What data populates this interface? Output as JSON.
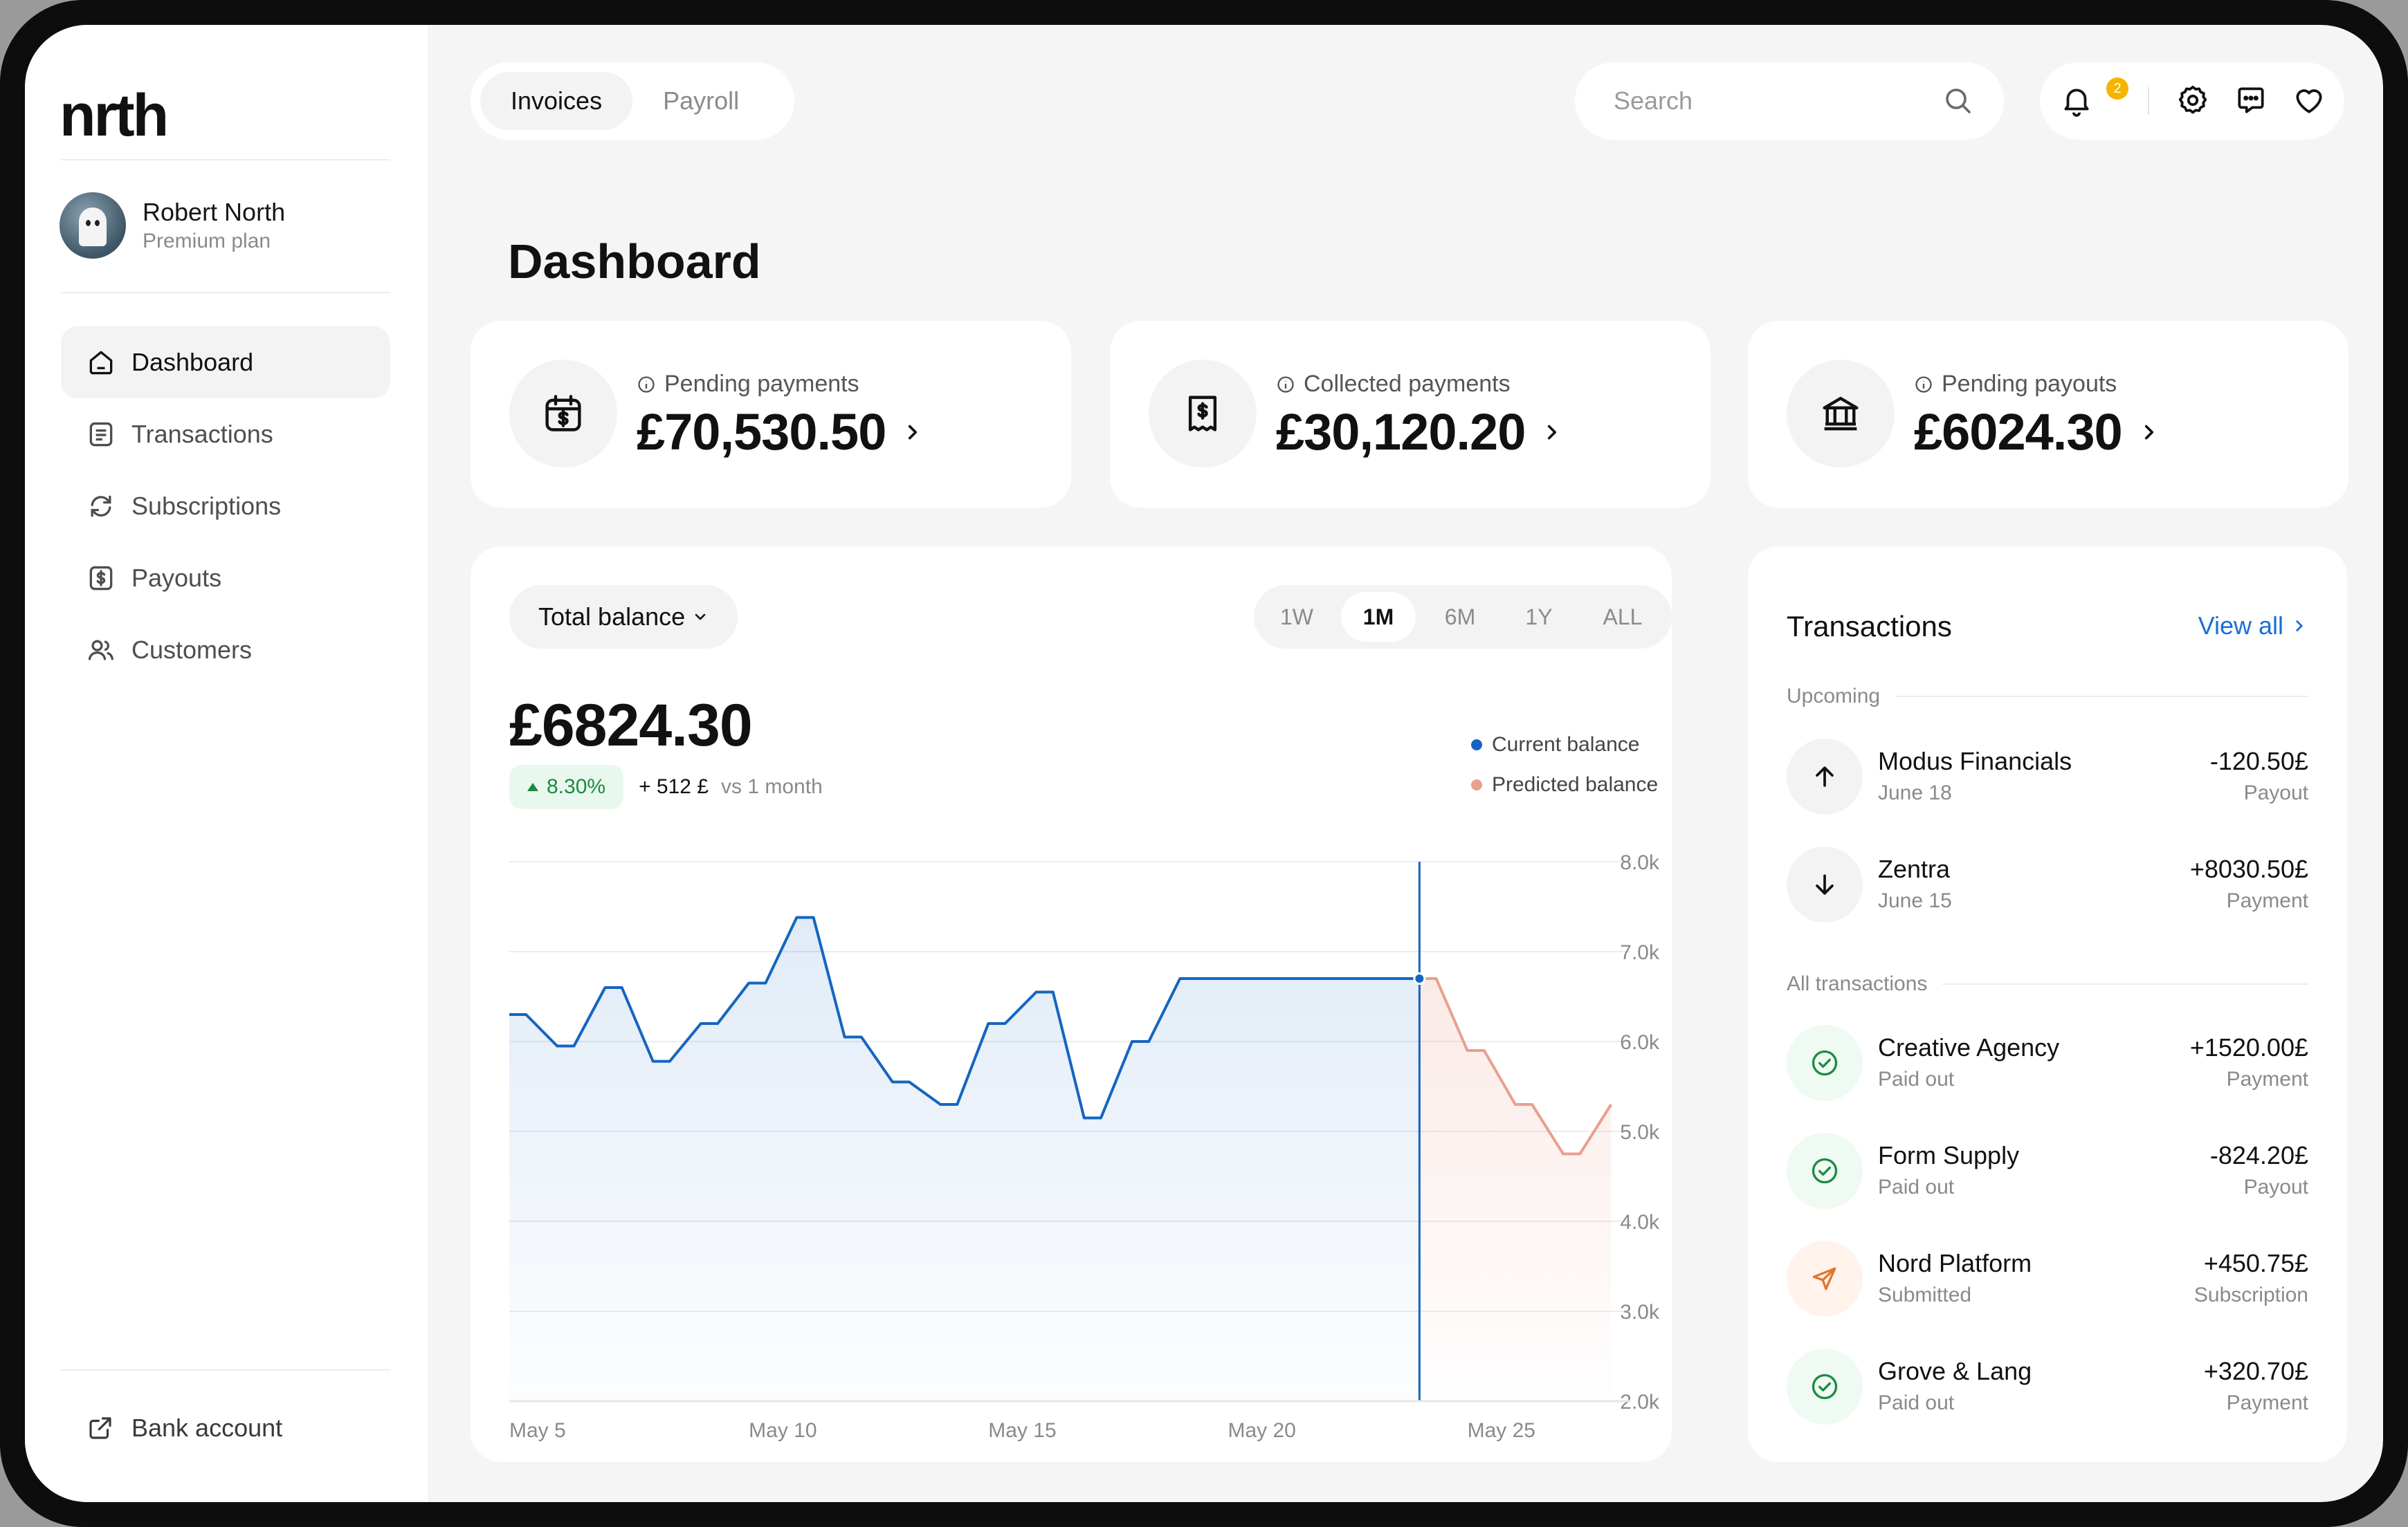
{
  "app": {
    "logo": "nrth"
  },
  "user": {
    "name": "Robert North",
    "plan": "Premium plan"
  },
  "sidebar": {
    "items": [
      {
        "label": "Dashboard",
        "icon": "home-icon",
        "active": true
      },
      {
        "label": "Transactions",
        "icon": "list-icon"
      },
      {
        "label": "Subscriptions",
        "icon": "refresh-icon"
      },
      {
        "label": "Payouts",
        "icon": "dollar-icon"
      },
      {
        "label": "Customers",
        "icon": "users-icon"
      }
    ],
    "bank_account": "Bank account"
  },
  "topbar": {
    "tabs": [
      {
        "label": "Invoices",
        "active": true
      },
      {
        "label": "Payroll"
      }
    ],
    "search_placeholder": "Search",
    "notification_count": "2"
  },
  "page_title": "Dashboard",
  "stats": [
    {
      "label": "Pending payments",
      "value": "£70,530.50",
      "icon": "calendar-dollar-icon"
    },
    {
      "label": "Collected payments",
      "value": "£30,120.20",
      "icon": "receipt-icon"
    },
    {
      "label": "Pending payouts",
      "value": "£6024.30",
      "icon": "bank-icon"
    }
  ],
  "balance": {
    "selector": "Total balance",
    "ranges": [
      "1W",
      "1M",
      "6M",
      "1Y",
      "ALL"
    ],
    "active_range": "1M",
    "amount": "£6824.30",
    "change_pct": "8.30%",
    "change_abs": "+ 512 £",
    "change_period": "vs 1 month",
    "legend": [
      {
        "label": "Current balance",
        "color": "#1565c0"
      },
      {
        "label": "Predicted balance",
        "color": "#e8a08e"
      }
    ]
  },
  "chart_data": {
    "type": "line",
    "x_ticks": [
      "May 5",
      "May 10",
      "May 15",
      "May 20",
      "May 25"
    ],
    "y_ticks": [
      "8.0k",
      "7.0k",
      "6.0k",
      "5.0k",
      "4.0k",
      "3.0k",
      "2.0k"
    ],
    "ylim": [
      2000,
      8000
    ],
    "series": [
      {
        "name": "Current balance",
        "color": "#1565c0",
        "x": [
          "May 5",
          "May 6",
          "May 7",
          "May 8",
          "May 9",
          "May 10",
          "May 11",
          "May 12",
          "May 13",
          "May 14",
          "May 15",
          "May 16",
          "May 17",
          "May 18",
          "May 19",
          "May 20",
          "May 21",
          "May 22",
          "May 23",
          "May 24"
        ],
        "values": [
          6300,
          5950,
          6600,
          5780,
          6200,
          6650,
          7380,
          6050,
          5550,
          5300,
          6200,
          6550,
          5150,
          6000,
          6700,
          6700,
          6700,
          6700,
          6700,
          6700
        ]
      },
      {
        "name": "Predicted balance",
        "color": "#e8a08e",
        "x": [
          "May 24",
          "May 25",
          "May 26",
          "May 27",
          "May 28"
        ],
        "values": [
          6700,
          5900,
          5300,
          4750,
          5300
        ]
      }
    ],
    "cursor": "May 24"
  },
  "transactions": {
    "title": "Transactions",
    "view_all": "View all",
    "upcoming_label": "Upcoming",
    "all_label": "All transactions",
    "upcoming": [
      {
        "name": "Modus Financials",
        "date": "June 18",
        "amount": "-120.50£",
        "type": "Payout",
        "icon": "arrow-up-icon"
      },
      {
        "name": "Zentra",
        "date": "June 15",
        "amount": "+8030.50£",
        "type": "Payment",
        "icon": "arrow-down-icon"
      }
    ],
    "all": [
      {
        "name": "Creative Agency",
        "status": "Paid out",
        "amount": "+1520.00£",
        "type": "Payment",
        "icon": "check-circle-icon"
      },
      {
        "name": "Form Supply",
        "status": "Paid out",
        "amount": "-824.20£",
        "type": "Payout",
        "icon": "check-circle-icon"
      },
      {
        "name": "Nord Platform",
        "status": "Submitted",
        "amount": "+450.75£",
        "type": "Subscription",
        "icon": "send-icon"
      },
      {
        "name": "Grove & Lang",
        "status": "Paid out",
        "amount": "+320.70£",
        "type": "Payment",
        "icon": "check-circle-icon"
      }
    ]
  }
}
